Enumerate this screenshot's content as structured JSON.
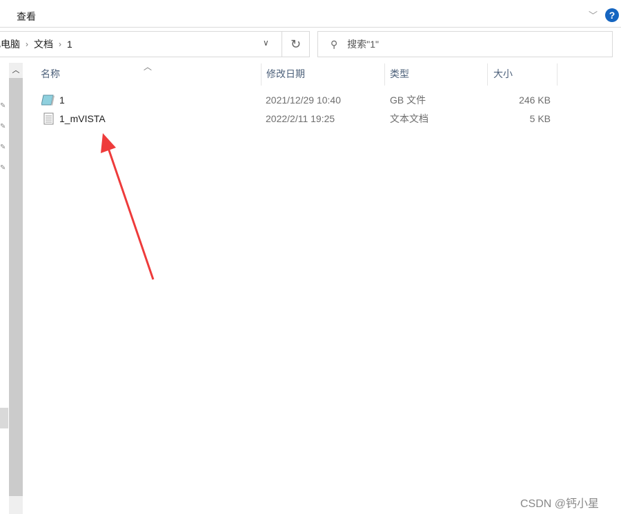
{
  "ribbon": {
    "tab": "查看",
    "help": "?"
  },
  "address": {
    "crumbs": [
      "此电脑",
      "文档",
      "1"
    ],
    "refresh": "↻"
  },
  "search": {
    "placeholder": "搜索\"1\""
  },
  "columns": {
    "name": "名称",
    "date": "修改日期",
    "type": "类型",
    "size": "大小"
  },
  "files": [
    {
      "name": "1",
      "date": "2021/12/29 10:40",
      "type": "GB 文件",
      "size": "246 KB",
      "icon": "gb-file-icon"
    },
    {
      "name": "1_mVISTA",
      "date": "2022/2/11 19:25",
      "type": "文本文档",
      "size": "5 KB",
      "icon": "text-file-icon"
    }
  ],
  "annotation": {
    "color": "#ee3b3b"
  },
  "watermark": "CSDN @钙小星"
}
